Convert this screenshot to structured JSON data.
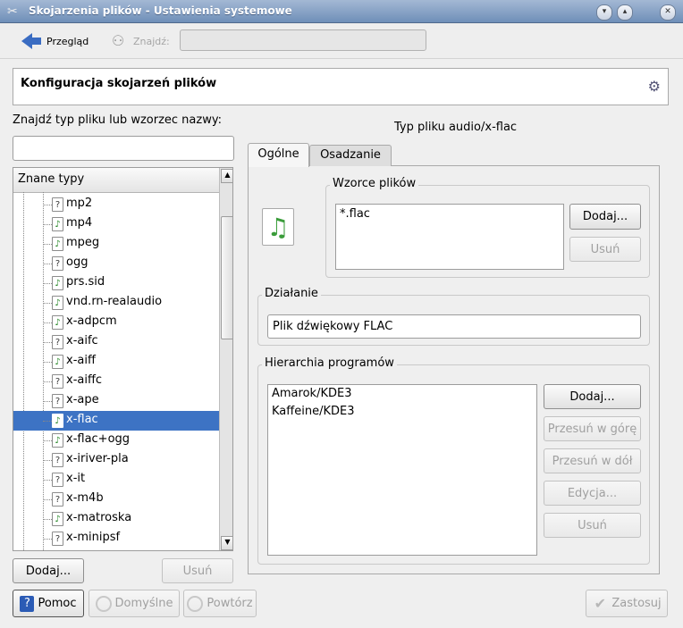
{
  "window": {
    "title": "Skojarzenia plików - Ustawienia systemowe",
    "controls": [
      "minimize",
      "maximize",
      "close"
    ]
  },
  "toolbar": {
    "back_label": "Przegląd",
    "find_label": "Znajdź:",
    "search_value": ""
  },
  "header": {
    "title": "Konfiguracja skojarzeń plików"
  },
  "left": {
    "search_label": "Znajdź typ pliku lub wzorzec nazwy:",
    "search_value": "",
    "tree_header": "Znane typy",
    "items": [
      {
        "label": "mp2",
        "icon": "unknown-file-icon",
        "selected": false
      },
      {
        "label": "mp4",
        "icon": "audio-file-icon",
        "selected": false
      },
      {
        "label": "mpeg",
        "icon": "audio-file-icon",
        "selected": false
      },
      {
        "label": "ogg",
        "icon": "unknown-file-icon",
        "selected": false
      },
      {
        "label": "prs.sid",
        "icon": "audio-file-icon",
        "selected": false
      },
      {
        "label": "vnd.rn-realaudio",
        "icon": "audio-file-icon",
        "selected": false
      },
      {
        "label": "x-adpcm",
        "icon": "audio-file-icon",
        "selected": false
      },
      {
        "label": "x-aifc",
        "icon": "unknown-file-icon",
        "selected": false
      },
      {
        "label": "x-aiff",
        "icon": "audio-file-icon",
        "selected": false
      },
      {
        "label": "x-aiffc",
        "icon": "unknown-file-icon",
        "selected": false
      },
      {
        "label": "x-ape",
        "icon": "unknown-file-icon",
        "selected": false
      },
      {
        "label": "x-flac",
        "icon": "audio-file-icon",
        "selected": true
      },
      {
        "label": "x-flac+ogg",
        "icon": "audio-file-icon",
        "selected": false
      },
      {
        "label": "x-iriver-pla",
        "icon": "unknown-file-icon",
        "selected": false
      },
      {
        "label": "x-it",
        "icon": "unknown-file-icon",
        "selected": false
      },
      {
        "label": "x-m4b",
        "icon": "unknown-file-icon",
        "selected": false
      },
      {
        "label": "x-matroska",
        "icon": "audio-file-icon",
        "selected": false
      },
      {
        "label": "x-minipsf",
        "icon": "unknown-file-icon",
        "selected": false
      }
    ],
    "add_label": "Dodaj...",
    "remove_label": "Usuń"
  },
  "right": {
    "type_title": "Typ pliku audio/x-flac",
    "tabs": [
      {
        "label": "Ogólne",
        "active": true
      },
      {
        "label": "Osadzanie",
        "active": false
      }
    ],
    "patterns": {
      "title": "Wzorce plików",
      "items": [
        "*.flac"
      ],
      "add_label": "Dodaj...",
      "remove_label": "Usuń"
    },
    "description": {
      "title": "Działanie",
      "value": "Plik dźwiękowy FLAC"
    },
    "programs": {
      "title": "Hierarchia programów",
      "items": [
        "Amarok/KDE3",
        "Kaffeine/KDE3"
      ],
      "add_label": "Dodaj...",
      "move_up_label": "Przesuń w górę",
      "move_down_label": "Przesuń w dół",
      "edit_label": "Edycja...",
      "remove_label": "Usuń"
    }
  },
  "footer": {
    "help_label": "Pomoc",
    "defaults_label": "Domyślne",
    "reset_label": "Powtórz",
    "apply_label": "Zastosuj"
  },
  "colors": {
    "selection": "#3d73c4",
    "titlebar": "#7f9cc2"
  }
}
